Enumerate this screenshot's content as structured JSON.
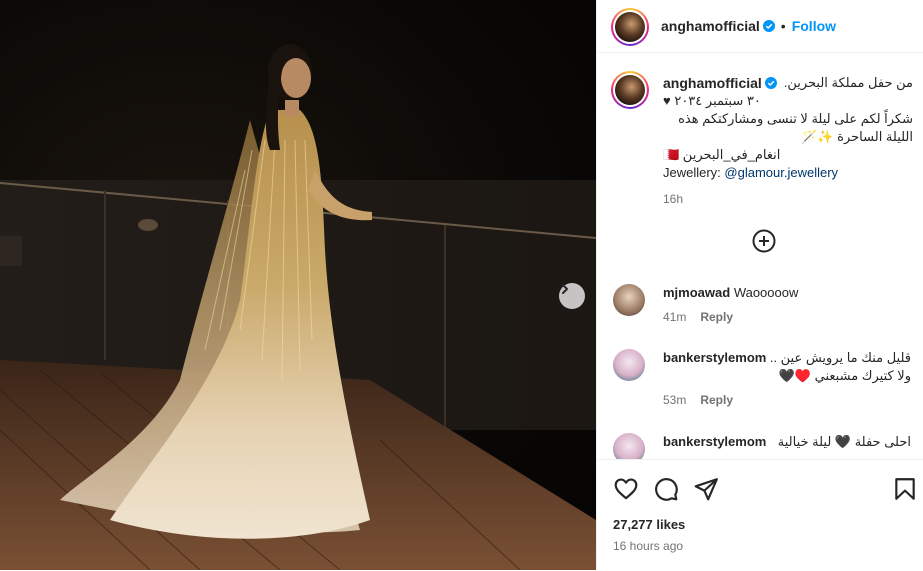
{
  "post": {
    "username": "anghamofficial",
    "follow_label": "Follow",
    "dot": "•",
    "caption": {
      "line1": "من حفل مملكة البحرين.",
      "line2": "٣٠ سبتمبر ٢٠٣٤ ♥",
      "line3": "شكراً لكم على ليلة لا تنسى ومشاركتكم هذه الليلة الساحرة ✨🪄",
      "line4": "انغام_في_البحرين 🇧🇭",
      "jewellery_prefix": "Jewellery: ",
      "jewellery_tag": "@glamour.jewellery"
    },
    "caption_time": "16h",
    "likes": "27,277 likes",
    "time_ago": "16 hours ago"
  },
  "comments": [
    {
      "username": "mjmoawad",
      "text": "Waooooow",
      "time": "41m",
      "reply": "Reply"
    },
    {
      "username": "bankerstylemom",
      "text": "قليل منك ما يرويش عين .. ولا كتيرك مشبعني ♥️🖤",
      "time": "53m",
      "reply": "Reply"
    },
    {
      "username": "bankerstylemom",
      "text": "احلى حفلة 🖤 ليلة خيالية",
      "time": "",
      "reply": ""
    }
  ],
  "icons": {
    "verified": "verified-badge-icon",
    "next": "chevron-right-icon",
    "add_comment": "plus-circle-icon",
    "like": "heart-icon",
    "comment": "comment-icon",
    "share": "share-icon",
    "save": "bookmark-icon"
  },
  "colors": {
    "accent": "#0095f6",
    "text": "#262626",
    "muted": "#737373",
    "link": "#00376b"
  }
}
